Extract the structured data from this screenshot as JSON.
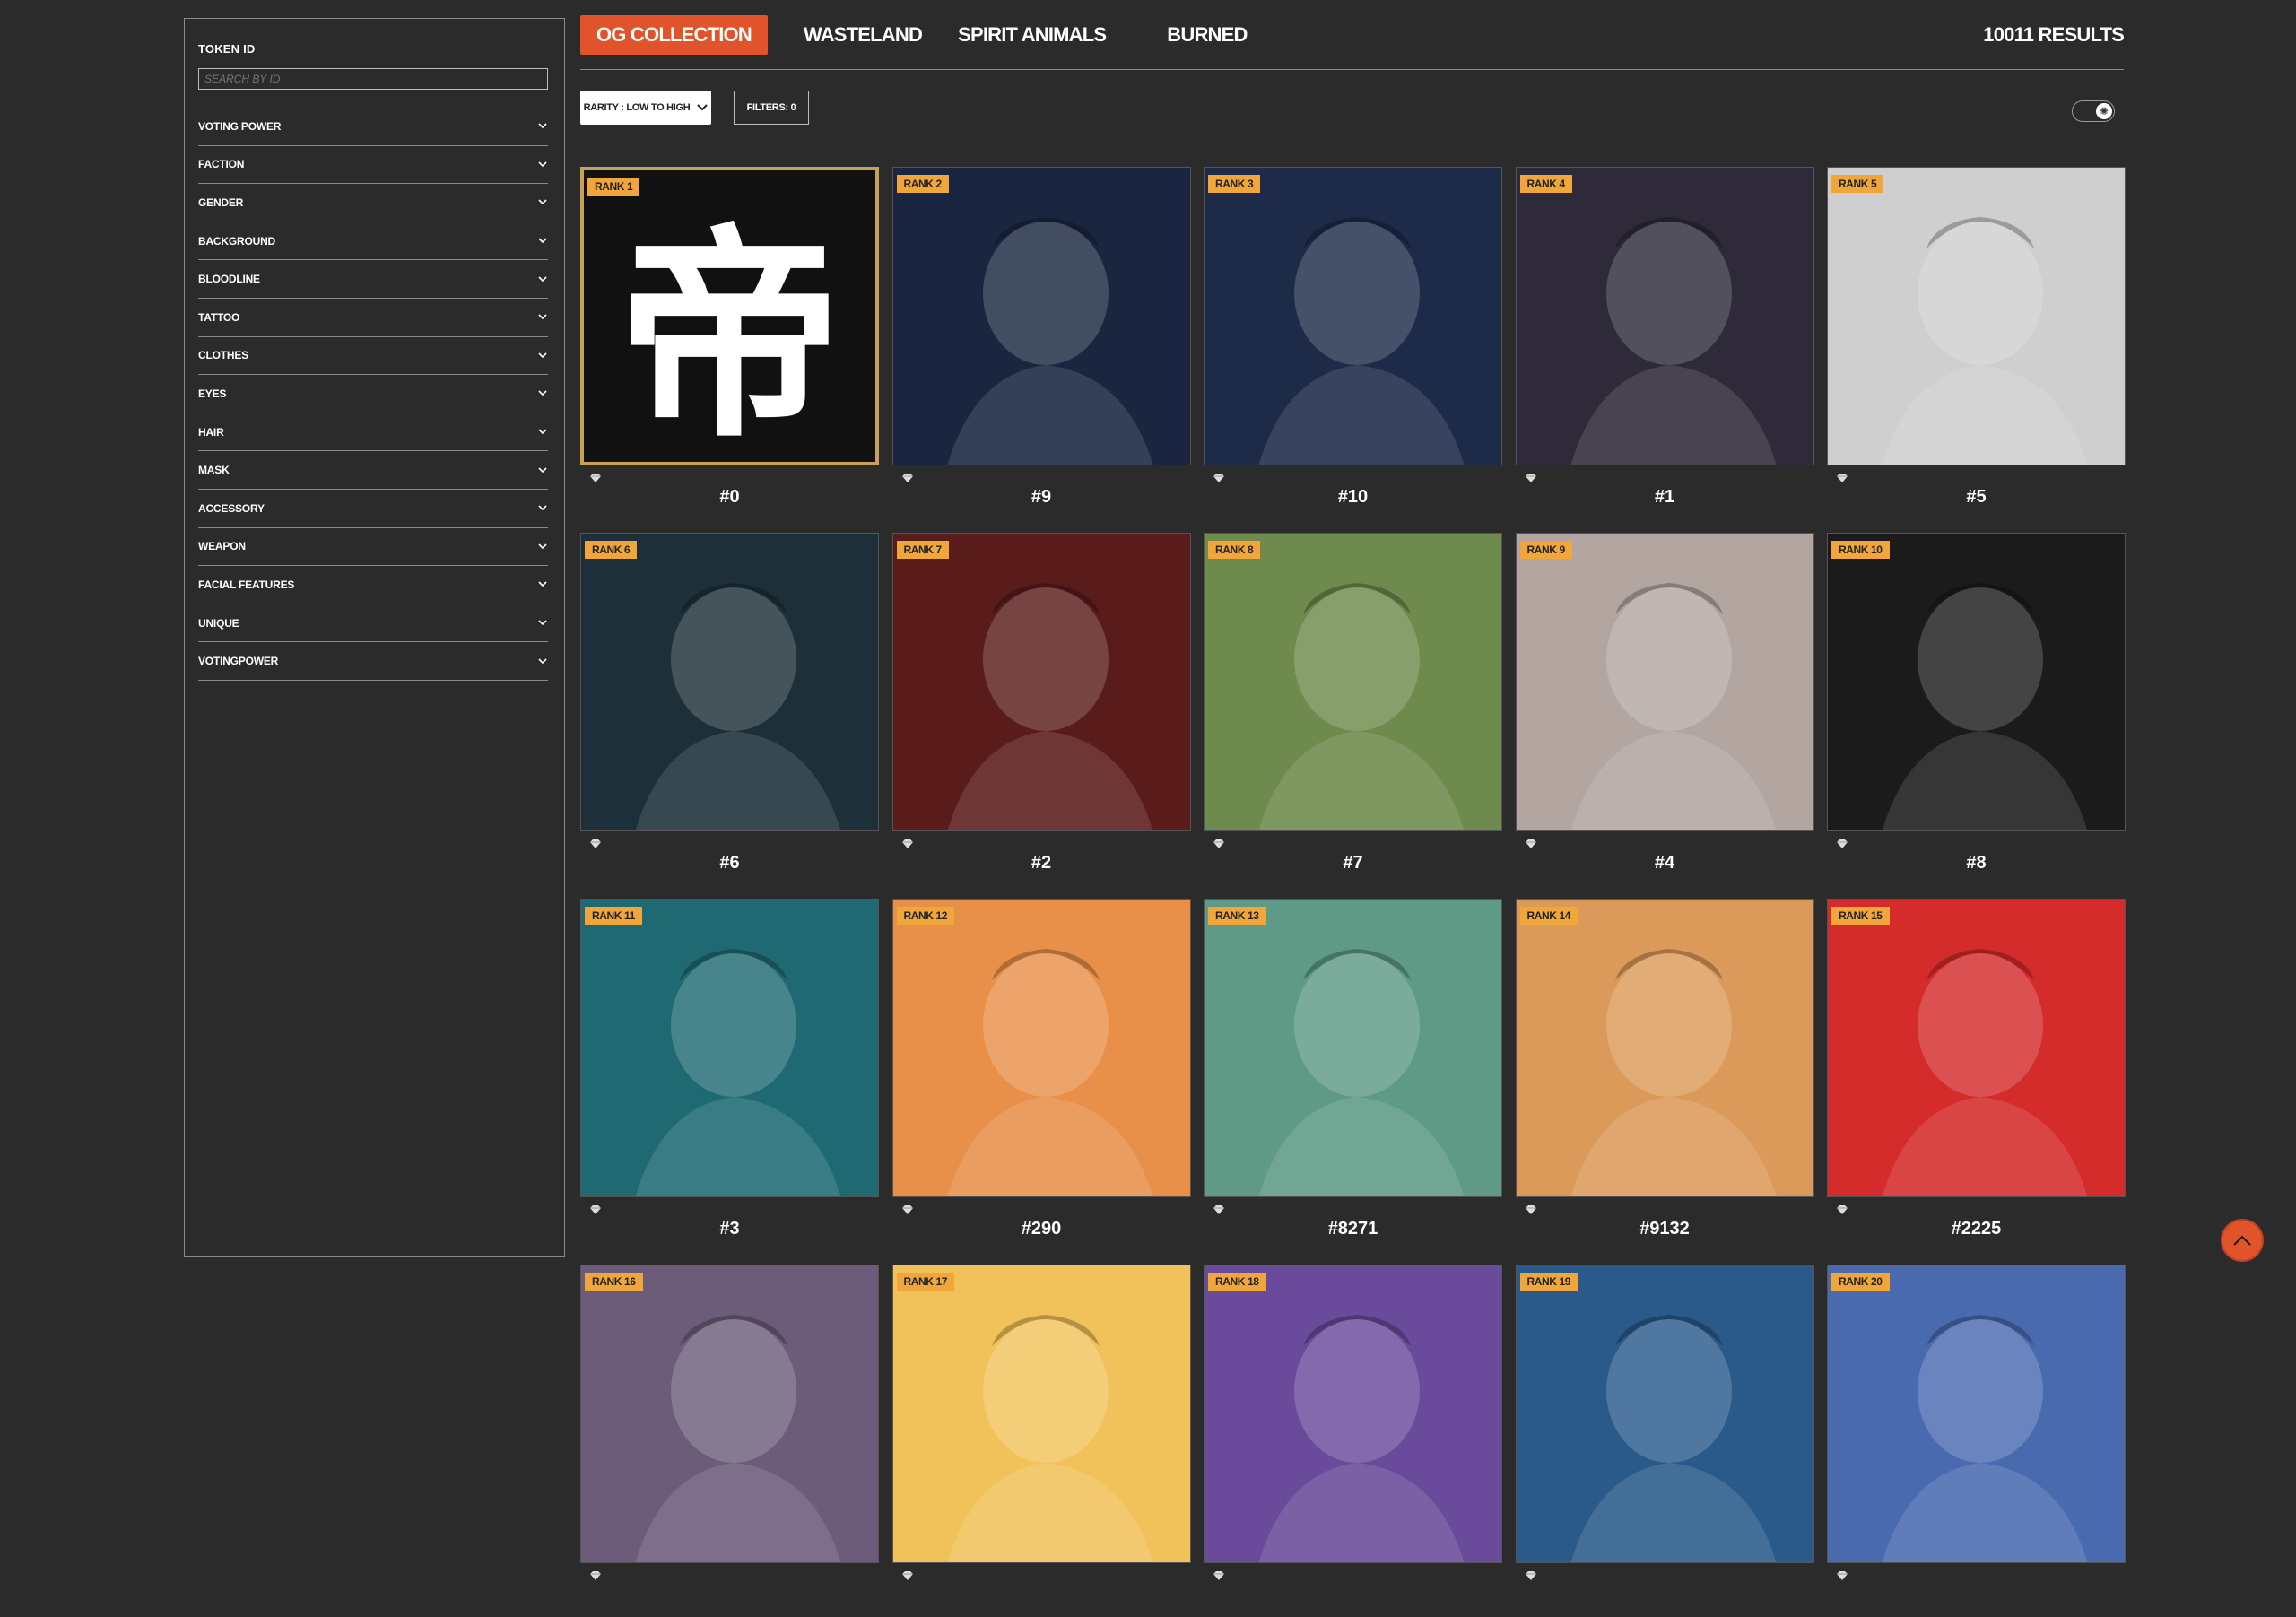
{
  "sidebar": {
    "token_label": "TOKEN ID",
    "search_placeholder": "SEARCH BY ID",
    "filters": [
      "VOTING POWER",
      "FACTION",
      "GENDER",
      "BACKGROUND",
      "BLOODLINE",
      "TATTOO",
      "CLOTHES",
      "EYES",
      "HAIR",
      "MASK",
      "ACCESSORY",
      "WEAPON",
      "FACIAL FEATURES",
      "UNIQUE",
      "VOTINGPOWER"
    ]
  },
  "tabs": [
    "OG COLLECTION",
    "WASTELAND",
    "SPIRIT ANIMALS",
    "BURNED"
  ],
  "results": "10011  RESULTS",
  "toolbar": {
    "sort_label": "RARITY : LOW TO HIGH",
    "filters_label": "FILTERS: 0"
  },
  "cards": [
    {
      "rank": "RANK 1",
      "id": "#0",
      "bg": "#111111"
    },
    {
      "rank": "RANK 2",
      "id": "#9",
      "bg": "#1a2640"
    },
    {
      "rank": "RANK 3",
      "id": "#10",
      "bg": "#1d2a48"
    },
    {
      "rank": "RANK 4",
      "id": "#1",
      "bg": "#2e2a3a"
    },
    {
      "rank": "RANK 5",
      "id": "#5",
      "bg": "#cfcfcf"
    },
    {
      "rank": "RANK 6",
      "id": "#6",
      "bg": "#1d2f38"
    },
    {
      "rank": "RANK 7",
      "id": "#2",
      "bg": "#5a1b1b"
    },
    {
      "rank": "RANK 8",
      "id": "#7",
      "bg": "#6e8a4c"
    },
    {
      "rank": "RANK 9",
      "id": "#4",
      "bg": "#b3a6a1"
    },
    {
      "rank": "RANK 10",
      "id": "#8",
      "bg": "#1b1b1b"
    },
    {
      "rank": "RANK 11",
      "id": "#3",
      "bg": "#1f6a72"
    },
    {
      "rank": "RANK 12",
      "id": "#290",
      "bg": "#e8904a"
    },
    {
      "rank": "RANK 13",
      "id": "#8271",
      "bg": "#5e9a86"
    },
    {
      "rank": "RANK 14",
      "id": "#9132",
      "bg": "#dc9a5a"
    },
    {
      "rank": "RANK 15",
      "id": "#2225",
      "bg": "#d42b2b"
    },
    {
      "rank": "RANK 16",
      "id": "",
      "bg": "#6c5c7a"
    },
    {
      "rank": "RANK 17",
      "id": "",
      "bg": "#f1c25a"
    },
    {
      "rank": "RANK 18",
      "id": "",
      "bg": "#6a4a9a"
    },
    {
      "rank": "RANK 19",
      "id": "",
      "bg": "#2a5a8a"
    },
    {
      "rank": "RANK 20",
      "id": "",
      "bg": "#4a6ab0"
    }
  ],
  "emblem_char": "帝",
  "colors": {
    "accent": "#e0532b",
    "rank_badge": "#f0a63a",
    "background": "#2b2b2b"
  }
}
